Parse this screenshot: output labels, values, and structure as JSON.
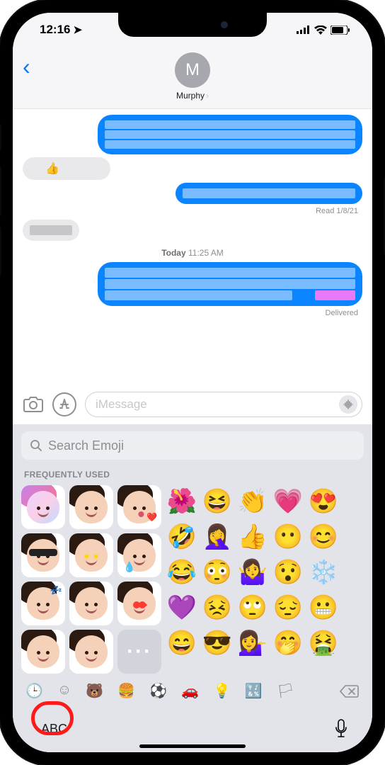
{
  "status": {
    "time": "12:16",
    "location_icon": "◤"
  },
  "header": {
    "avatar_initial": "M",
    "contact_name": "Murphy"
  },
  "chat": {
    "read_receipt": "Read 1/8/21",
    "timestamp_day": "Today",
    "timestamp_time": "11:25 AM",
    "delivered": "Delivered"
  },
  "compose": {
    "placeholder": "iMessage"
  },
  "emoji_panel": {
    "search_placeholder": "Search Emoji",
    "section_label": "FREQUENTLY USED",
    "emoji_list": [
      "🌺",
      "😆",
      "👏",
      "💗",
      "😍",
      "🤣",
      "🤦‍♀️",
      "👍",
      "😶",
      "😊",
      "😂",
      "😳",
      "🤷‍♀️",
      "😯",
      "❄️",
      "💜",
      "😣",
      "🙄",
      "😔",
      "😬",
      "😄",
      "😎",
      "💁‍♀️",
      "🤭",
      "🤮"
    ]
  },
  "bottom": {
    "abc_label": "ABC"
  }
}
